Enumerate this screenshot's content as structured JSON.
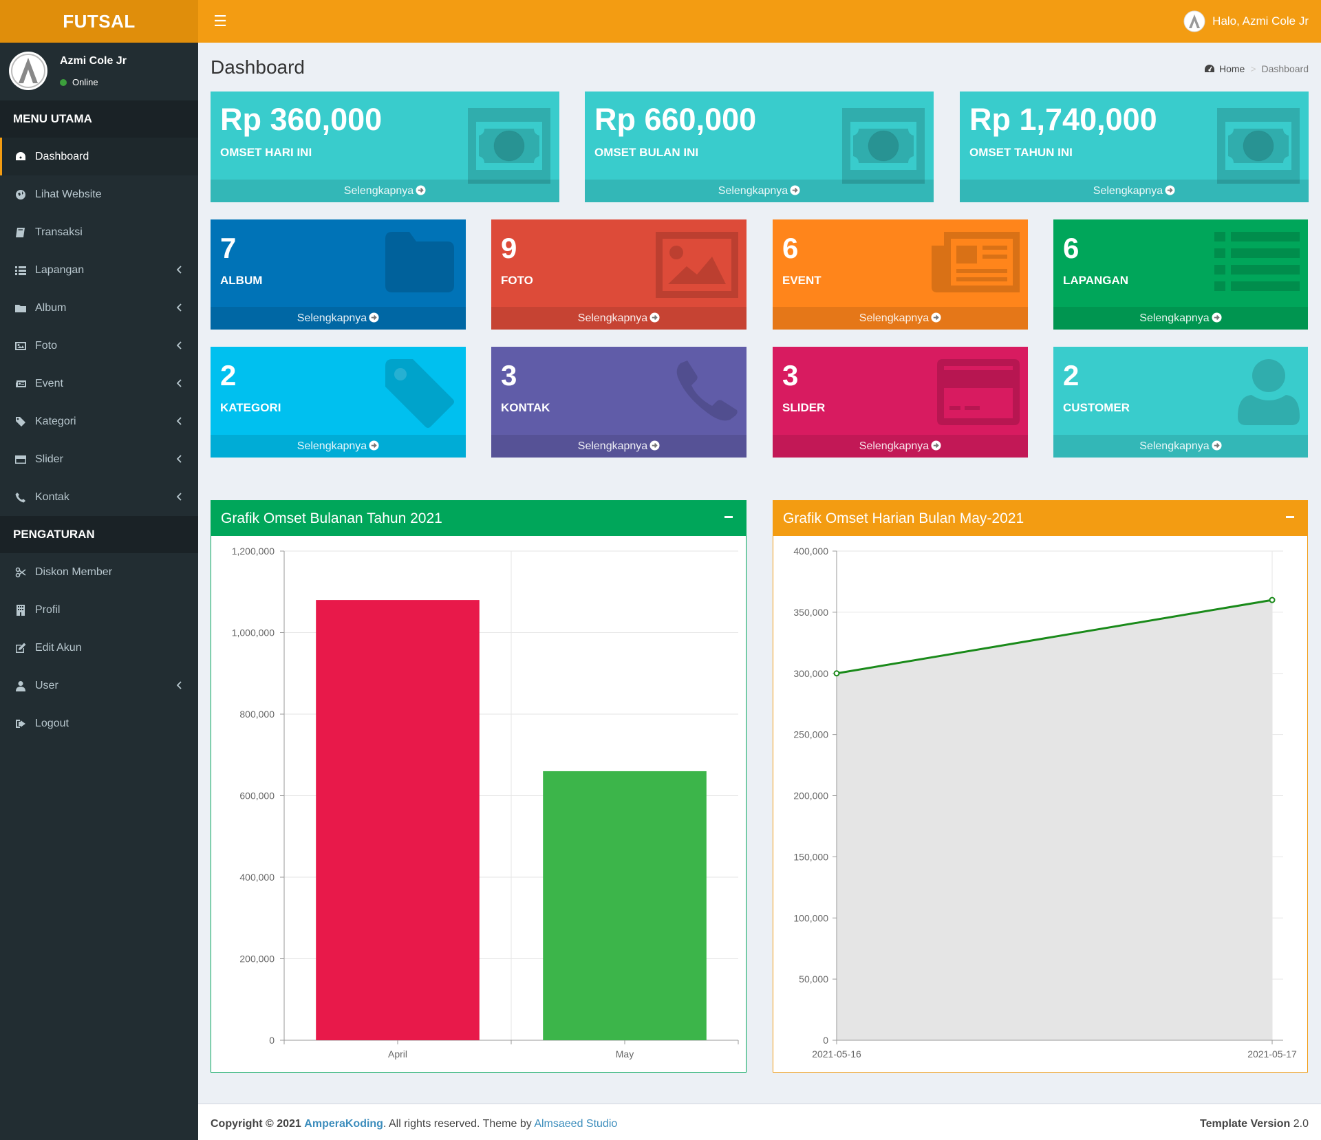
{
  "app": {
    "logo_text": "FUTSAL",
    "header_greeting": "Halo, Azmi Cole Jr"
  },
  "user": {
    "name": "Azmi Cole Jr",
    "status": "Online"
  },
  "sidebar": {
    "main_header": "MENU UTAMA",
    "main_items": [
      {
        "label": "Dashboard",
        "icon": "dashboard-icon",
        "active": true
      },
      {
        "label": "Lihat Website",
        "icon": "globe-icon"
      },
      {
        "label": "Transaksi",
        "icon": "book-icon"
      },
      {
        "label": "Lapangan",
        "icon": "list-icon",
        "submenu": true
      },
      {
        "label": "Album",
        "icon": "folder-icon",
        "submenu": true
      },
      {
        "label": "Foto",
        "icon": "image-icon",
        "submenu": true
      },
      {
        "label": "Event",
        "icon": "newspaper-icon",
        "submenu": true
      },
      {
        "label": "Kategori",
        "icon": "tag-icon",
        "submenu": true
      },
      {
        "label": "Slider",
        "icon": "credit-card-icon",
        "submenu": true
      },
      {
        "label": "Kontak",
        "icon": "phone-icon",
        "submenu": true
      }
    ],
    "settings_header": "PENGATURAN",
    "settings_items": [
      {
        "label": "Diskon Member",
        "icon": "scissors-icon"
      },
      {
        "label": "Profil",
        "icon": "building-icon"
      },
      {
        "label": "Edit Akun",
        "icon": "edit-icon"
      },
      {
        "label": "User",
        "icon": "user-icon",
        "submenu": true
      },
      {
        "label": "Logout",
        "icon": "sign-out-icon"
      }
    ]
  },
  "page": {
    "title": "Dashboard",
    "breadcrumb_home": "Home",
    "breadcrumb_current": "Dashboard"
  },
  "stats_revenue": [
    {
      "value": "Rp 360,000",
      "label": "OMSET HARI INI",
      "more": "Selengkapnya",
      "color": "#39cccc"
    },
    {
      "value": "Rp 660,000",
      "label": "OMSET BULAN INI",
      "more": "Selengkapnya",
      "color": "#39cccc"
    },
    {
      "value": "Rp 1,740,000",
      "label": "OMSET TAHUN INI",
      "more": "Selengkapnya",
      "color": "#39cccc"
    }
  ],
  "stats_row1": [
    {
      "value": "7",
      "label": "ALBUM",
      "more": "Selengkapnya",
      "color": "#0073b7",
      "icon": "folder-icon"
    },
    {
      "value": "9",
      "label": "FOTO",
      "more": "Selengkapnya",
      "color": "#dd4b39",
      "icon": "image-icon"
    },
    {
      "value": "6",
      "label": "EVENT",
      "more": "Selengkapnya",
      "color": "#ff851b",
      "icon": "newspaper-icon"
    },
    {
      "value": "6",
      "label": "LAPANGAN",
      "more": "Selengkapnya",
      "color": "#00a65a",
      "icon": "list-icon"
    }
  ],
  "stats_row2": [
    {
      "value": "2",
      "label": "KATEGORI",
      "more": "Selengkapnya",
      "color": "#00c0ef",
      "icon": "tag-icon"
    },
    {
      "value": "3",
      "label": "KONTAK",
      "more": "Selengkapnya",
      "color": "#605ca8",
      "icon": "phone-icon"
    },
    {
      "value": "3",
      "label": "SLIDER",
      "more": "Selengkapnya",
      "color": "#d81b60",
      "icon": "credit-card-icon"
    },
    {
      "value": "2",
      "label": "CUSTOMER",
      "more": "Selengkapnya",
      "color": "#39cccc",
      "icon": "user-icon"
    }
  ],
  "charts": {
    "monthly_title": "Grafik Omset Bulanan Tahun 2021",
    "daily_title": "Grafik Omset Harian Bulan May-2021",
    "monthly_color": "#00a65a",
    "daily_color": "#f39c12"
  },
  "chart_data": [
    {
      "type": "bar",
      "title": "Grafik Omset Bulanan Tahun 2021",
      "categories": [
        "April",
        "May"
      ],
      "values": [
        1080000,
        660000
      ],
      "bar_colors": [
        "#e8194a",
        "#3cb54a"
      ],
      "ylim": [
        0,
        1200000
      ],
      "yticks": [
        0,
        200000,
        400000,
        600000,
        800000,
        1000000,
        1200000
      ],
      "ytick_labels": [
        "0",
        "200,000",
        "400,000",
        "600,000",
        "800,000",
        "1,000,000",
        "1,200,000"
      ],
      "grid": true
    },
    {
      "type": "area",
      "title": "Grafik Omset Harian Bulan May-2021",
      "x": [
        "2021-05-16",
        "2021-05-17"
      ],
      "values": [
        300000,
        360000
      ],
      "line_color": "#1a8a1a",
      "fill_color": "#e5e5e5",
      "ylim": [
        0,
        400000
      ],
      "yticks": [
        0,
        50000,
        100000,
        150000,
        200000,
        250000,
        300000,
        350000,
        400000
      ],
      "ytick_labels": [
        "0",
        "50,000",
        "100,000",
        "150,000",
        "200,000",
        "250,000",
        "300,000",
        "350,000",
        "400,000"
      ],
      "grid": true
    }
  ],
  "footer": {
    "copyright_prefix": "Copyright © 2021",
    "company": "AmperaKoding",
    "rights": ". All rights reserved. Theme by ",
    "theme_author": "Almsaeed Studio",
    "version_label": "Template Version",
    "version": "2.0"
  }
}
